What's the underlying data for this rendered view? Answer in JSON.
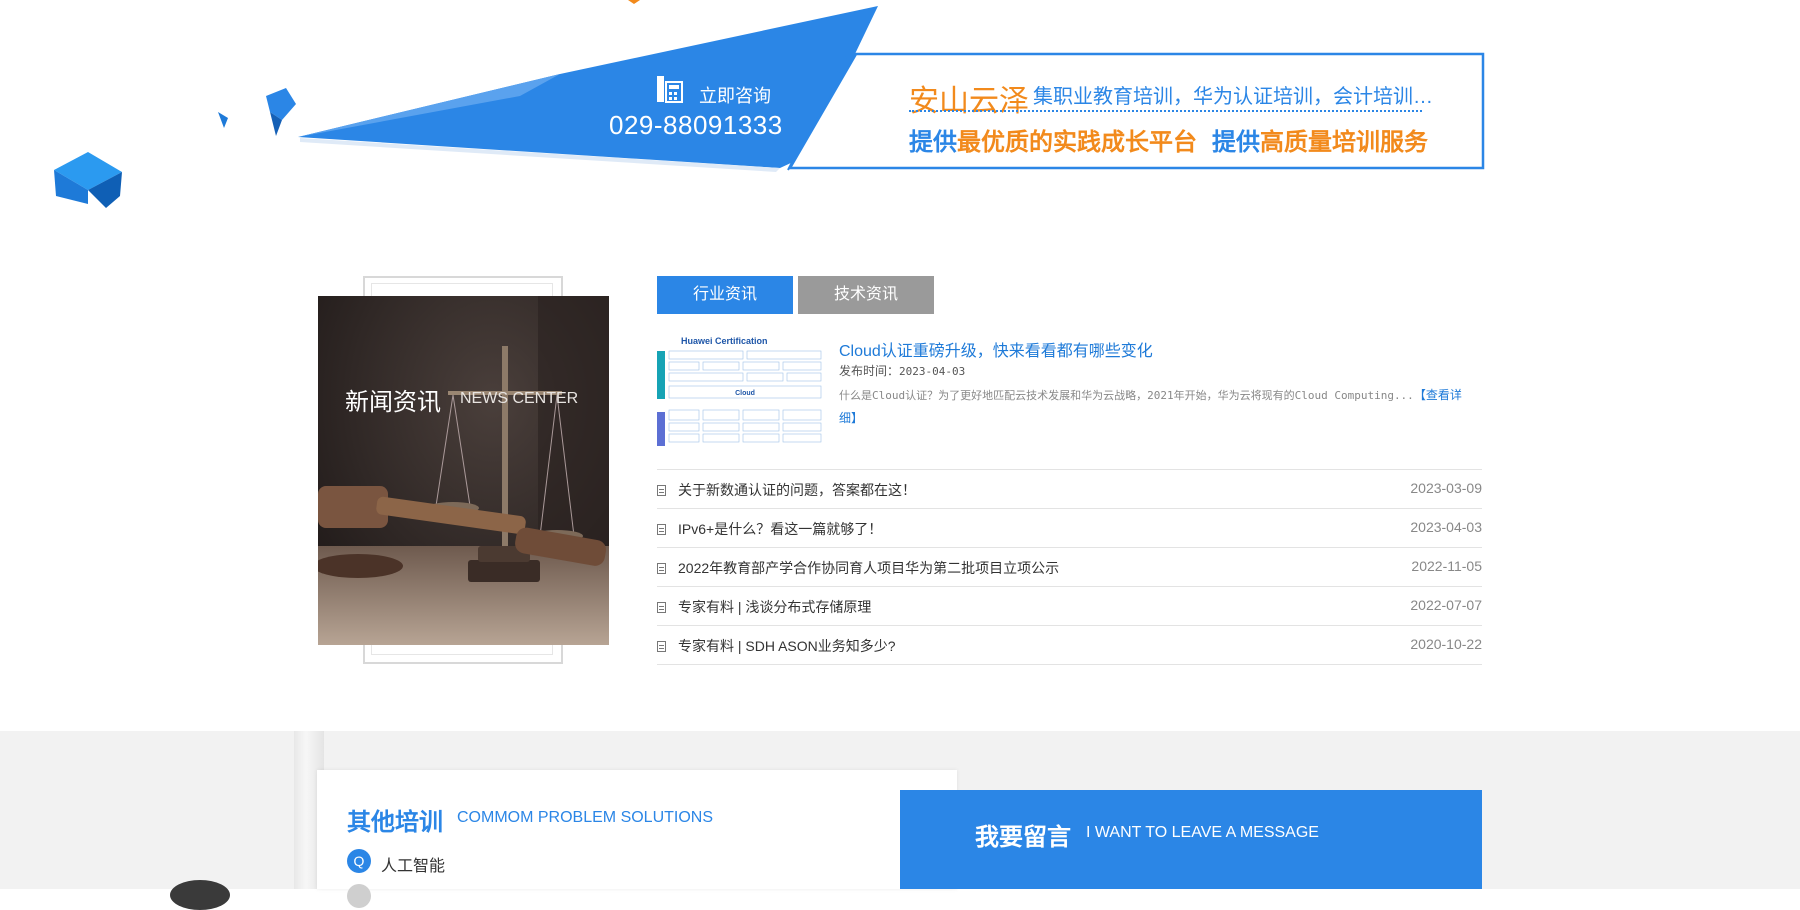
{
  "colors": {
    "accent": "#2b86e6",
    "orange": "#f28a1c",
    "tab_inactive": "#9a9a9a"
  },
  "banner": {
    "consult_label": "立即咨询",
    "phone": "029-88091333",
    "brand_name": "安山云泽",
    "brand_desc": "集职业教育培训，华为认证培训，会计培训…",
    "slogan1": {
      "prefix": "提供",
      "highlight": "最优质的实践成长平台"
    },
    "slogan2": {
      "prefix": "提供",
      "highlight": "高质量培训服务"
    }
  },
  "news": {
    "title_cn": "新闻资讯",
    "title_en": "NEWS CENTER",
    "tabs": [
      {
        "label": "行业资讯",
        "active": true
      },
      {
        "label": "技术资讯",
        "active": false
      }
    ],
    "featured": {
      "thumb_title": "Huawei Certification",
      "thumb_bar": "Cloud",
      "title": "Cloud认证重磅升级，快来看看都有哪些变化",
      "date_label": "发布时间：",
      "date": "2023-04-03",
      "summary": "什么是Cloud认证？为了更好地匹配云技术发展和华为云战略，2021年开始，华为云将现有的Cloud Computing...",
      "more": "【查看详细】"
    },
    "items": [
      {
        "title": "关于新数通认证的问题，答案都在这！",
        "date": "2023-03-09"
      },
      {
        "title": "IPv6+是什么？看这一篇就够了！",
        "date": "2023-04-03"
      },
      {
        "title": "2022年教育部产学合作协同育人项目华为第二批项目立项公示",
        "date": "2022-11-05"
      },
      {
        "title": "专家有料 | 浅谈分布式存储原理",
        "date": "2022-07-07"
      },
      {
        "title": "专家有料 | SDH ASON业务知多少?",
        "date": "2020-10-22"
      }
    ]
  },
  "other": {
    "title": "其他培训",
    "subtitle": "COMMOM PROBLEM SOLUTIONS",
    "q_badge": "Q",
    "first_item": "人工智能"
  },
  "message": {
    "title": "我要留言",
    "subtitle": "I WANT TO LEAVE A MESSAGE"
  }
}
